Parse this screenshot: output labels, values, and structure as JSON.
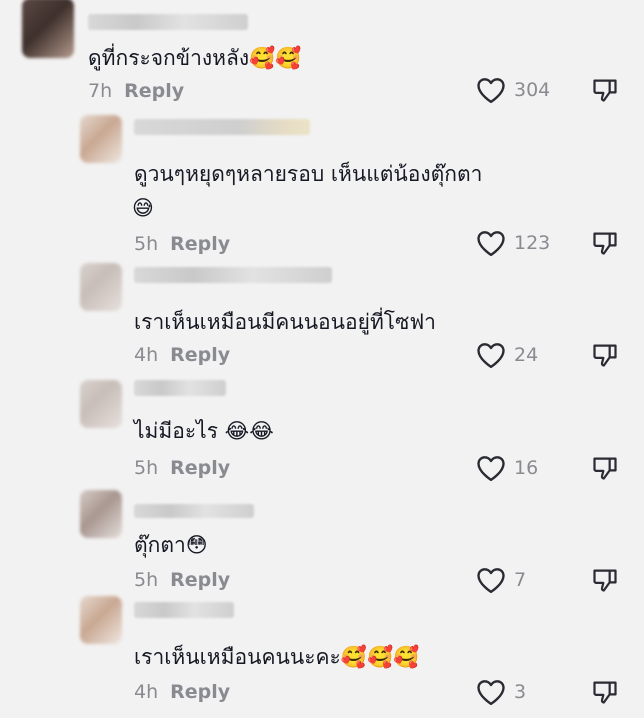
{
  "reply_label": "Reply",
  "comments": [
    {
      "text": "ดูที่กระจกข้างหลัง🥰🥰",
      "text2": "",
      "time": "7h",
      "likes": "304"
    },
    {
      "text": "ดูวนๆหยุดๆหลายรอบ เห็นแต่น้องตุ๊กตา",
      "text2": "😅",
      "time": "5h",
      "likes": "123"
    },
    {
      "text": "เราเห็นเหมือนมีคนนอนอยู่ที่โซฟา",
      "text2": "",
      "time": "4h",
      "likes": "24"
    },
    {
      "text": "ไม่มีอะไร 😂😂",
      "text2": "",
      "time": "5h",
      "likes": "16"
    },
    {
      "text": "ตุ๊กตา😳",
      "text2": "",
      "time": "5h",
      "likes": "7"
    },
    {
      "text": "เราเห็นเหมือนคนนะคะ🥰🥰🥰",
      "text2": "",
      "time": "4h",
      "likes": "3"
    }
  ],
  "colors": {
    "background": "#f2f2f2",
    "text": "#161823",
    "meta": "#8a8b91"
  }
}
